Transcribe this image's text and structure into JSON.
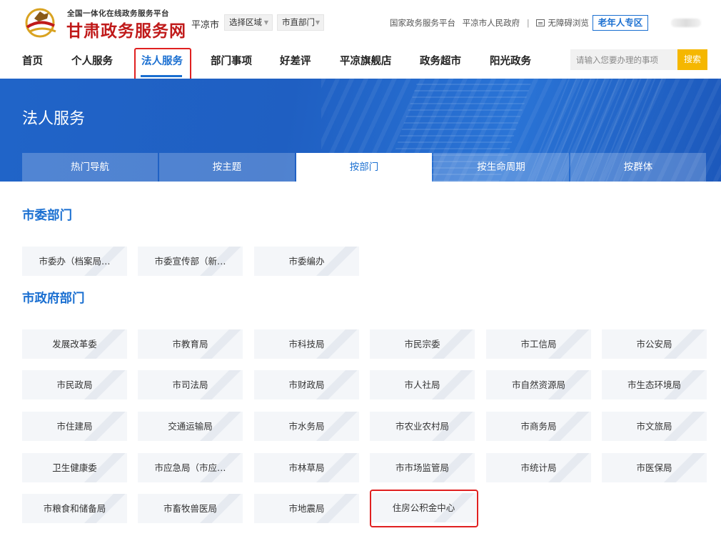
{
  "header": {
    "brand_small": "全国一体化在线政务服务平台",
    "brand_name": "甘肃政务服务网",
    "city": "平凉市",
    "region_select": "选择区域",
    "dept_select": "市直部门",
    "links": [
      "国家政务服务平台",
      "平凉市人民政府"
    ],
    "accessibility": "无障碍浏览",
    "elder_zone": "老年人专区"
  },
  "nav": {
    "items": [
      "首页",
      "个人服务",
      "法人服务",
      "部门事项",
      "好差评",
      "平凉旗舰店",
      "政务超市",
      "阳光政务"
    ],
    "active": "法人服务",
    "search_placeholder": "请输入您要办理的事项",
    "search_button": "搜索"
  },
  "banner": {
    "title": "法人服务",
    "tabs": [
      "热门导航",
      "按主题",
      "按部门",
      "按生命周期",
      "按群体"
    ],
    "active_tab": "按部门"
  },
  "sections": [
    {
      "title": "市委部门",
      "items": [
        "市委办（档案局…",
        "市委宣传部（新…",
        "市委编办"
      ]
    },
    {
      "title": "市政府部门",
      "items": [
        "发展改革委",
        "市教育局",
        "市科技局",
        "市民宗委",
        "市工信局",
        "市公安局",
        "市民政局",
        "市司法局",
        "市财政局",
        "市人社局",
        "市自然资源局",
        "市生态环境局",
        "市住建局",
        "交通运输局",
        "市水务局",
        "市农业农村局",
        "市商务局",
        "市文旅局",
        "卫生健康委",
        "市应急局（市应…",
        "市林草局",
        "市市场监管局",
        "市统计局",
        "市医保局",
        "市粮食和储备局",
        "市畜牧兽医局",
        "市地震局",
        "住房公积金中心"
      ]
    }
  ],
  "colors": {
    "accent": "#1a6fd1",
    "brand_red": "#c01a1a",
    "search_yellow": "#f5b700",
    "highlight_red": "#e02020",
    "card_bg": "#f4f6f9"
  },
  "icons": [
    "gansu-logo-icon",
    "accessibility-icon",
    "caret-down-icon"
  ]
}
